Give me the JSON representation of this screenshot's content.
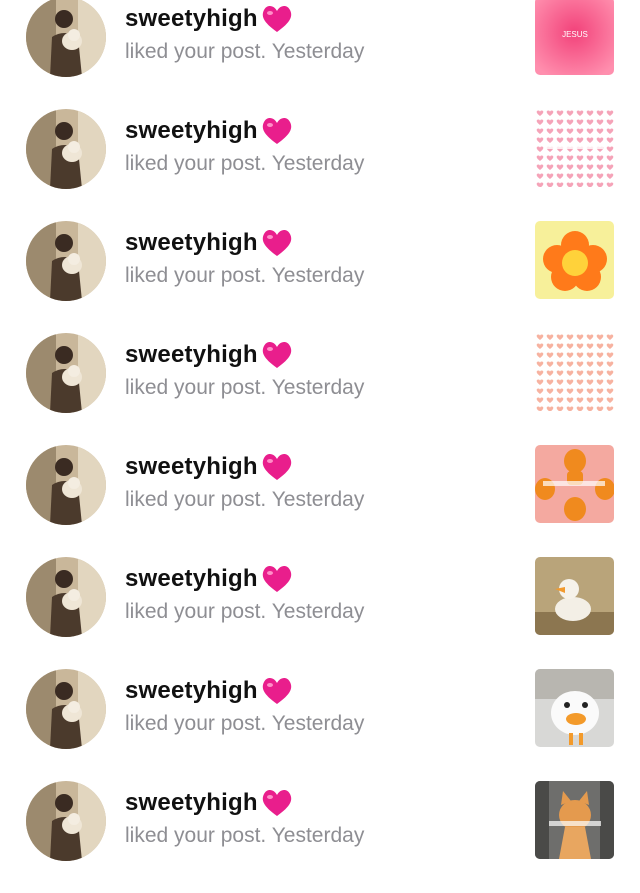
{
  "notifications": [
    {
      "username": "sweetyhigh",
      "action": "liked your post.",
      "time": "Yesterday",
      "thumbnail": "pink-post-thumbnail"
    },
    {
      "username": "sweetyhigh",
      "action": "liked your post.",
      "time": "Yesterday",
      "thumbnail": "heart-pattern-post-thumbnail"
    },
    {
      "username": "sweetyhigh",
      "action": "liked your post.",
      "time": "Yesterday",
      "thumbnail": "orange-flower-post-thumbnail"
    },
    {
      "username": "sweetyhigh",
      "action": "liked your post.",
      "time": "Yesterday",
      "thumbnail": "heart-pattern-post-thumbnail"
    },
    {
      "username": "sweetyhigh",
      "action": "liked your post.",
      "time": "Yesterday",
      "thumbnail": "cartoon-pattern-post-thumbnail"
    },
    {
      "username": "sweetyhigh",
      "action": "liked your post.",
      "time": "Yesterday",
      "thumbnail": "duck-post-thumbnail"
    },
    {
      "username": "sweetyhigh",
      "action": "liked your post.",
      "time": "Yesterday",
      "thumbnail": "duck-closeup-post-thumbnail"
    },
    {
      "username": "sweetyhigh",
      "action": "liked your post.",
      "time": "Yesterday",
      "thumbnail": "cat-post-thumbnail"
    }
  ],
  "thumb_texts": {
    "pink": "JESUS"
  },
  "colors": {
    "heart": "#e91e8c",
    "secondary_text": "#8e8e93"
  }
}
